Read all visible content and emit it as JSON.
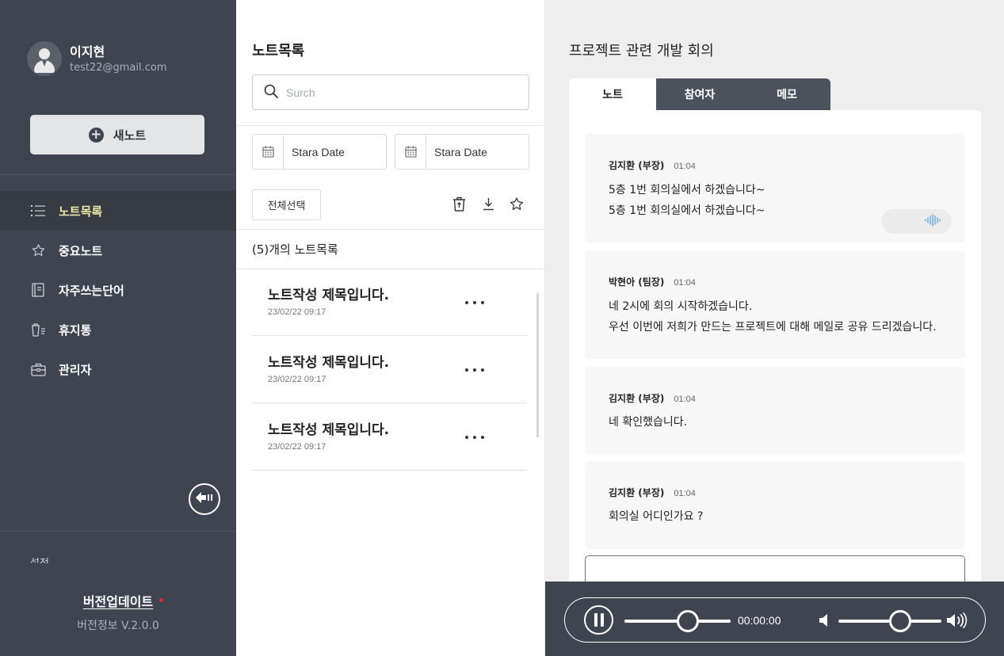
{
  "user": {
    "name": "이지현",
    "email": "test22@gmail.com"
  },
  "sidebar": {
    "new_note_label": "새노트",
    "items": [
      {
        "label": "노트목록",
        "icon": "list-icon",
        "active": true
      },
      {
        "label": "중요노트",
        "icon": "star-icon",
        "active": false
      },
      {
        "label": "자주쓰는단어",
        "icon": "book-icon",
        "active": false
      },
      {
        "label": "휴지통",
        "icon": "trash-icon",
        "active": false
      },
      {
        "label": "관리자",
        "icon": "briefcase-icon",
        "active": false
      }
    ],
    "hidden_item_label": "설정",
    "version_update_label": "버전업데이트",
    "version_info": "버전정보 V.2.0.0",
    "active_color": "#eceaa7"
  },
  "notes_panel": {
    "title": "노트목록",
    "search_placeholder": "Surch",
    "start_date_label": "Stara Date",
    "end_date_label": "Stara Date",
    "select_all_label": "전체선택",
    "count_text": "(5)개의 노트목록",
    "notes": [
      {
        "title": "노트작성 제목입니다.",
        "date": "23/02/22 09:17"
      },
      {
        "title": "노트작성 제목입니다.",
        "date": "23/02/22 09:17"
      },
      {
        "title": "노트작성 제목입니다.",
        "date": "23/02/22 09:17"
      }
    ]
  },
  "detail": {
    "title": "프로젝트 관련 개발 회의",
    "tabs": [
      {
        "label": "노트",
        "active": true
      },
      {
        "label": "참여자",
        "active": false
      },
      {
        "label": "메모",
        "active": false
      }
    ],
    "messages": [
      {
        "speaker": "김지환 (부장)",
        "time": "01:04",
        "lines": [
          "5층 1번 회의실에서 하겠습니다~",
          "5층 1번 회의실에서 하겠습니다~"
        ],
        "has_audio": true
      },
      {
        "speaker": "박현아 (팀장)",
        "time": "01:04",
        "lines": [
          "네 2시에 회의 시작하겠습니다.",
          "우선 이번에 저희가 만드는 프로젝트에 대해 메일로 공유 드리겠습니다."
        ],
        "has_audio": false
      },
      {
        "speaker": "김지환 (부장)",
        "time": "01:04",
        "lines": [
          "네 확인했습니다."
        ],
        "has_audio": false
      },
      {
        "speaker": "김지환 (부장)",
        "time": "01:04",
        "lines": [
          "회의실 어디인가요 ?"
        ],
        "has_audio": false
      }
    ],
    "audio_accent": "#6aa9e0"
  },
  "player": {
    "time": "00:00:00",
    "progress": 0.6,
    "volume": 0.6
  }
}
